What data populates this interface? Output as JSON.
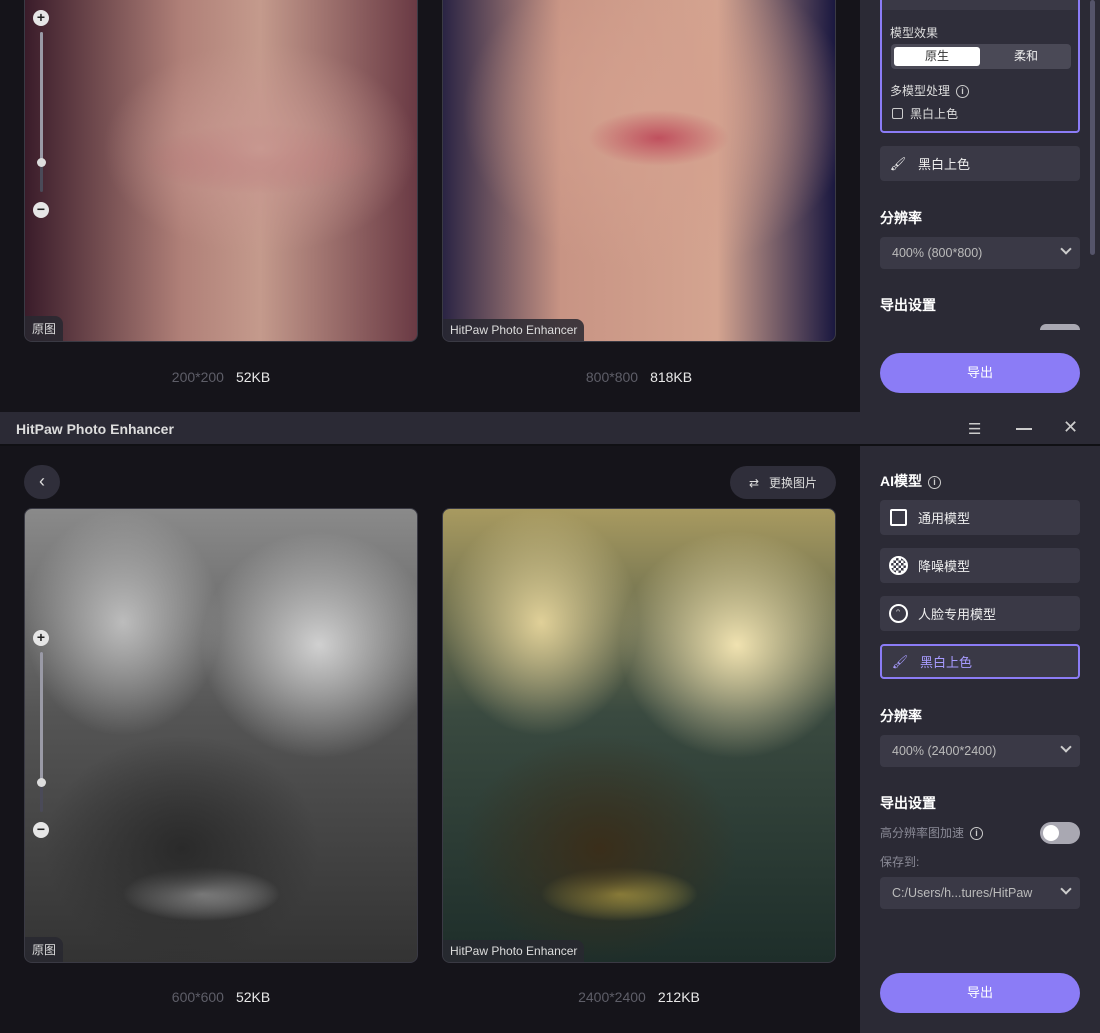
{
  "top": {
    "original_tag": "原图",
    "enhanced_tag": "HitPaw Photo Enhancer",
    "original_dim": "200*200",
    "original_size": "52KB",
    "enhanced_dim": "800*800",
    "enhanced_size": "818KB",
    "sidebar": {
      "model_effect_label": "模型效果",
      "effect_options": [
        "原生",
        "柔和"
      ],
      "multi_model_label": "多模型处理",
      "multi_model_checkbox": "黑白上色",
      "model_item": "黑白上色",
      "resolution_label": "分辨率",
      "resolution_value": "400% (800*800)",
      "export_settings_label": "导出设置",
      "export_button": "导出"
    }
  },
  "window": {
    "title": "HitPaw Photo Enhancer"
  },
  "bottom": {
    "change_image_button": "更换图片",
    "original_tag": "原图",
    "enhanced_tag": "HitPaw Photo Enhancer",
    "original_dim": "600*600",
    "original_size": "52KB",
    "enhanced_dim": "2400*2400",
    "enhanced_size": "212KB",
    "sidebar": {
      "ai_model_label": "AI模型",
      "models": [
        "通用模型",
        "降噪模型",
        "人脸专用模型",
        "黑白上色"
      ],
      "resolution_label": "分辨率",
      "resolution_value": "400% (2400*2400)",
      "export_settings_label": "导出设置",
      "hires_accel_label": "高分辨率图加速",
      "hires_accel_on": false,
      "save_to_label": "保存到:",
      "save_path": "C:/Users/h...tures/HitPaw",
      "export_button": "导出"
    }
  },
  "colors": {
    "accent": "#8b7cf6",
    "sidebar": "#2b2a35",
    "main": "#15141a"
  }
}
